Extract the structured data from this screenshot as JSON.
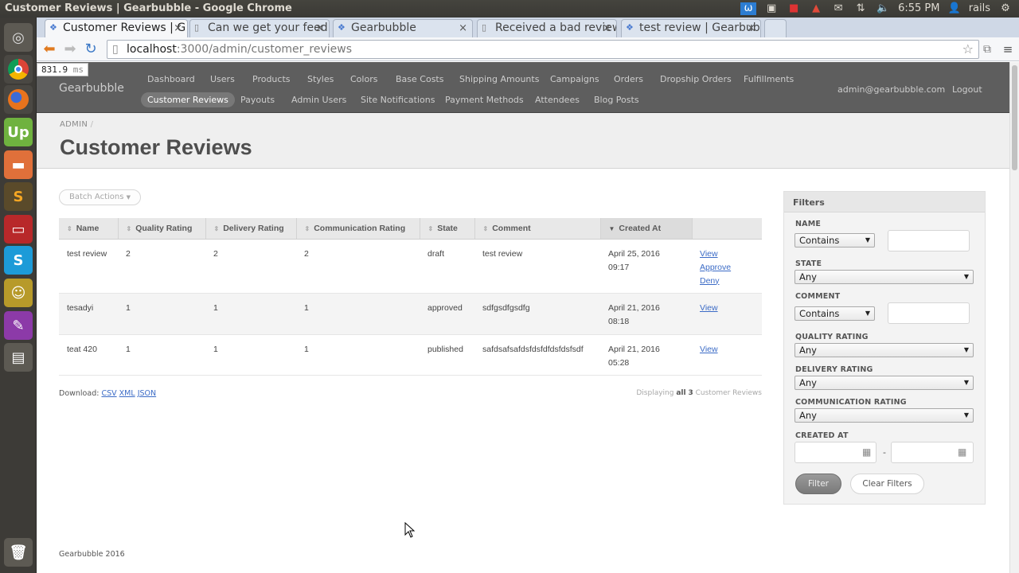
{
  "os": {
    "window_title": "Customer Reviews | Gearbubble - Google Chrome",
    "clock": "6:55 PM",
    "user": "rails"
  },
  "browser": {
    "tabs": [
      {
        "label": "Customer Reviews | G",
        "active": true
      },
      {
        "label": "Can we get your feed",
        "active": false
      },
      {
        "label": "Gearbubble",
        "active": false
      },
      {
        "label": "Received a bad review",
        "active": false
      },
      {
        "label": "test review | Gearbub",
        "active": false
      }
    ],
    "url_host": "localhost",
    "url_path": ":3000/admin/customer_reviews",
    "timing": "831.9",
    "timing_unit": "ms"
  },
  "header": {
    "site_title": "Gearbubble",
    "nav_row1": [
      "Dashboard",
      "Users",
      "Products",
      "Styles",
      "Colors",
      "Base Costs",
      "Shipping Amounts",
      "Campaigns",
      "Orders",
      "Dropship Orders",
      "Fulfillments"
    ],
    "nav_row2": [
      "Customer Reviews",
      "Payouts",
      "Admin Users",
      "Site Notifications",
      "Payment Methods",
      "Attendees",
      "Blog Posts"
    ],
    "current_user": "admin@gearbubble.com",
    "logout": "Logout"
  },
  "title_bar": {
    "breadcrumb": "ADMIN",
    "breadcrumb_sep": "/",
    "title": "Customer Reviews"
  },
  "main": {
    "batch_actions": "Batch Actions",
    "columns": [
      "Name",
      "Quality Rating",
      "Delivery Rating",
      "Communication Rating",
      "State",
      "Comment",
      "Created At"
    ],
    "rows": [
      {
        "name": "test review",
        "quality": "2",
        "delivery": "2",
        "communication": "2",
        "state": "draft",
        "comment": "test review",
        "created_date": "April 25, 2016",
        "created_time": "09:17",
        "actions": [
          "View",
          "Approve",
          "Deny"
        ]
      },
      {
        "name": "tesadyi",
        "quality": "1",
        "delivery": "1",
        "communication": "1",
        "state": "approved",
        "comment": "sdfgsdfgsdfg",
        "created_date": "April 21, 2016",
        "created_time": "08:18",
        "actions": [
          "View"
        ]
      },
      {
        "name": "teat 420",
        "quality": "1",
        "delivery": "1",
        "communication": "1",
        "state": "published",
        "comment": "safdsafsafdsfdsfdfdsfdsfsdf",
        "created_date": "April 21, 2016",
        "created_time": "05:28",
        "actions": [
          "View"
        ]
      }
    ],
    "download_label": "Download:",
    "download_links": [
      "CSV",
      "XML",
      "JSON"
    ],
    "pagination": {
      "prefix": "Displaying",
      "all": "all",
      "count": "3",
      "suffix": "Customer Reviews"
    }
  },
  "filters": {
    "title": "Filters",
    "name_label": "NAME",
    "name_op": "Contains",
    "state_label": "STATE",
    "state_value": "Any",
    "comment_label": "COMMENT",
    "comment_op": "Contains",
    "quality_label": "QUALITY RATING",
    "quality_value": "Any",
    "delivery_label": "DELIVERY RATING",
    "delivery_value": "Any",
    "communication_label": "COMMUNICATION RATING",
    "communication_value": "Any",
    "created_label": "CREATED AT",
    "date_sep": "-",
    "filter_button": "Filter",
    "clear_button": "Clear Filters"
  },
  "footer": {
    "text": "Gearbubble 2016"
  }
}
